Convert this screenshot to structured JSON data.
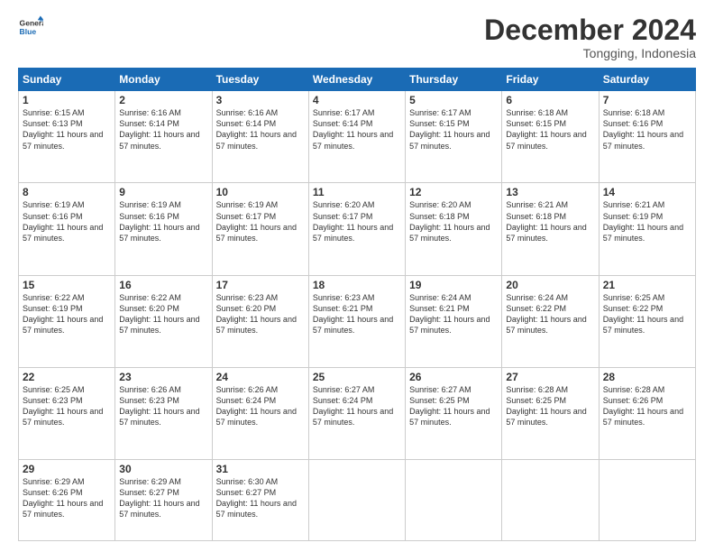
{
  "logo": {
    "line1": "General",
    "line2": "Blue"
  },
  "title": "December 2024",
  "subtitle": "Tongging, Indonesia",
  "header_days": [
    "Sunday",
    "Monday",
    "Tuesday",
    "Wednesday",
    "Thursday",
    "Friday",
    "Saturday"
  ],
  "weeks": [
    [
      {
        "day": "1",
        "sunrise": "6:15 AM",
        "sunset": "6:13 PM",
        "daylight": "11 hours and 57 minutes."
      },
      {
        "day": "2",
        "sunrise": "6:16 AM",
        "sunset": "6:14 PM",
        "daylight": "11 hours and 57 minutes."
      },
      {
        "day": "3",
        "sunrise": "6:16 AM",
        "sunset": "6:14 PM",
        "daylight": "11 hours and 57 minutes."
      },
      {
        "day": "4",
        "sunrise": "6:17 AM",
        "sunset": "6:14 PM",
        "daylight": "11 hours and 57 minutes."
      },
      {
        "day": "5",
        "sunrise": "6:17 AM",
        "sunset": "6:15 PM",
        "daylight": "11 hours and 57 minutes."
      },
      {
        "day": "6",
        "sunrise": "6:18 AM",
        "sunset": "6:15 PM",
        "daylight": "11 hours and 57 minutes."
      },
      {
        "day": "7",
        "sunrise": "6:18 AM",
        "sunset": "6:16 PM",
        "daylight": "11 hours and 57 minutes."
      }
    ],
    [
      {
        "day": "8",
        "sunrise": "6:19 AM",
        "sunset": "6:16 PM",
        "daylight": "11 hours and 57 minutes."
      },
      {
        "day": "9",
        "sunrise": "6:19 AM",
        "sunset": "6:16 PM",
        "daylight": "11 hours and 57 minutes."
      },
      {
        "day": "10",
        "sunrise": "6:19 AM",
        "sunset": "6:17 PM",
        "daylight": "11 hours and 57 minutes."
      },
      {
        "day": "11",
        "sunrise": "6:20 AM",
        "sunset": "6:17 PM",
        "daylight": "11 hours and 57 minutes."
      },
      {
        "day": "12",
        "sunrise": "6:20 AM",
        "sunset": "6:18 PM",
        "daylight": "11 hours and 57 minutes."
      },
      {
        "day": "13",
        "sunrise": "6:21 AM",
        "sunset": "6:18 PM",
        "daylight": "11 hours and 57 minutes."
      },
      {
        "day": "14",
        "sunrise": "6:21 AM",
        "sunset": "6:19 PM",
        "daylight": "11 hours and 57 minutes."
      }
    ],
    [
      {
        "day": "15",
        "sunrise": "6:22 AM",
        "sunset": "6:19 PM",
        "daylight": "11 hours and 57 minutes."
      },
      {
        "day": "16",
        "sunrise": "6:22 AM",
        "sunset": "6:20 PM",
        "daylight": "11 hours and 57 minutes."
      },
      {
        "day": "17",
        "sunrise": "6:23 AM",
        "sunset": "6:20 PM",
        "daylight": "11 hours and 57 minutes."
      },
      {
        "day": "18",
        "sunrise": "6:23 AM",
        "sunset": "6:21 PM",
        "daylight": "11 hours and 57 minutes."
      },
      {
        "day": "19",
        "sunrise": "6:24 AM",
        "sunset": "6:21 PM",
        "daylight": "11 hours and 57 minutes."
      },
      {
        "day": "20",
        "sunrise": "6:24 AM",
        "sunset": "6:22 PM",
        "daylight": "11 hours and 57 minutes."
      },
      {
        "day": "21",
        "sunrise": "6:25 AM",
        "sunset": "6:22 PM",
        "daylight": "11 hours and 57 minutes."
      }
    ],
    [
      {
        "day": "22",
        "sunrise": "6:25 AM",
        "sunset": "6:23 PM",
        "daylight": "11 hours and 57 minutes."
      },
      {
        "day": "23",
        "sunrise": "6:26 AM",
        "sunset": "6:23 PM",
        "daylight": "11 hours and 57 minutes."
      },
      {
        "day": "24",
        "sunrise": "6:26 AM",
        "sunset": "6:24 PM",
        "daylight": "11 hours and 57 minutes."
      },
      {
        "day": "25",
        "sunrise": "6:27 AM",
        "sunset": "6:24 PM",
        "daylight": "11 hours and 57 minutes."
      },
      {
        "day": "26",
        "sunrise": "6:27 AM",
        "sunset": "6:25 PM",
        "daylight": "11 hours and 57 minutes."
      },
      {
        "day": "27",
        "sunrise": "6:28 AM",
        "sunset": "6:25 PM",
        "daylight": "11 hours and 57 minutes."
      },
      {
        "day": "28",
        "sunrise": "6:28 AM",
        "sunset": "6:26 PM",
        "daylight": "11 hours and 57 minutes."
      }
    ],
    [
      {
        "day": "29",
        "sunrise": "6:29 AM",
        "sunset": "6:26 PM",
        "daylight": "11 hours and 57 minutes."
      },
      {
        "day": "30",
        "sunrise": "6:29 AM",
        "sunset": "6:27 PM",
        "daylight": "11 hours and 57 minutes."
      },
      {
        "day": "31",
        "sunrise": "6:30 AM",
        "sunset": "6:27 PM",
        "daylight": "11 hours and 57 minutes."
      },
      null,
      null,
      null,
      null
    ]
  ],
  "colors": {
    "header_bg": "#1a6bb5",
    "stripe_bg": "#f0f4fa"
  }
}
